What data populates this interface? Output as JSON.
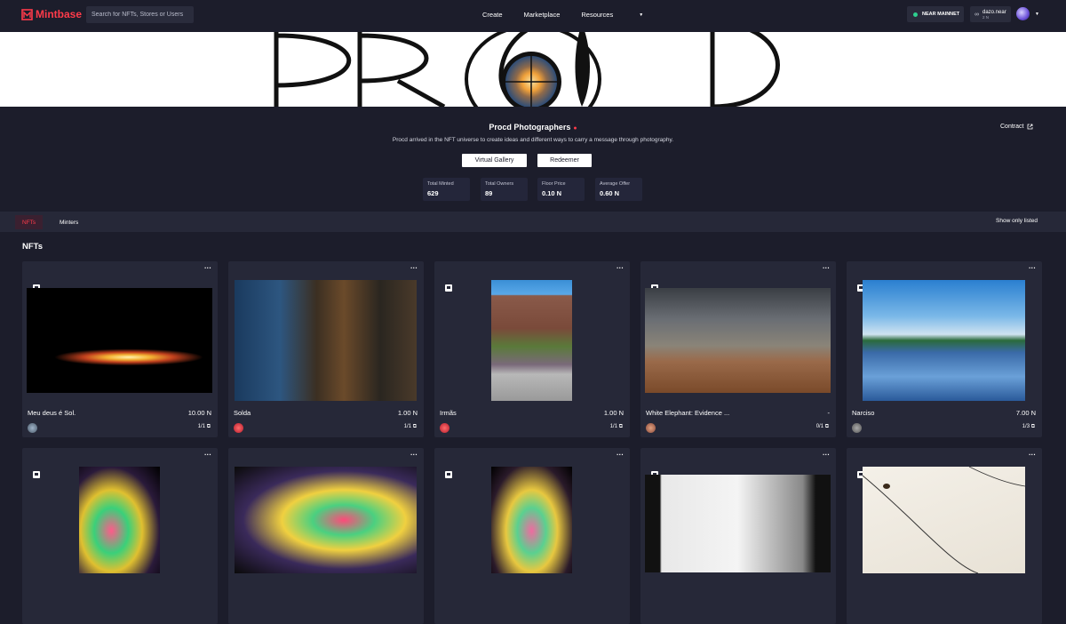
{
  "nav": {
    "logo_text": "Mintbase",
    "search_placeholder": "Search for NFTs, Stores or Users",
    "links": [
      "Create",
      "Marketplace",
      "Resources"
    ],
    "network": "NEAR MAINNET",
    "account_name": "dazo.near",
    "account_balance": "2 N"
  },
  "store": {
    "banner_text": "PROCD",
    "title": "Procd Photographers",
    "description": "Procd arrived in the NFT universe to create ideas and different ways to carry a message through photography.",
    "contract_label": "Contract",
    "buttons": [
      "Virtual Gallery",
      "Redeemer"
    ],
    "stats": [
      {
        "label": "Total Minted",
        "value": "629"
      },
      {
        "label": "Total Owners",
        "value": "89"
      },
      {
        "label": "Floor Price",
        "value": "0.10 N"
      },
      {
        "label": "Average Offer",
        "value": "0.60 N"
      }
    ]
  },
  "tabs": {
    "items": [
      "NFTs",
      "Minters"
    ],
    "active": "NFTs",
    "show_only_listed": "Show only listed"
  },
  "section_title": "NFTs",
  "cards": [
    {
      "name": "Meu deus é Sol.",
      "price": "10.00 N",
      "editions": "1/1",
      "owner_color": "#5a6b7c"
    },
    {
      "name": "Solda",
      "price": "1.00 N",
      "editions": "1/1",
      "owner_color": "#d7263d"
    },
    {
      "name": "Irmãs",
      "price": "1.00 N",
      "editions": "1/1",
      "owner_color": "#d7263d"
    },
    {
      "name": "White Elephant: Evidence ...",
      "price": "-",
      "editions": "0/1",
      "owner_color": "#b06a4a"
    },
    {
      "name": "Narciso",
      "price": "7.00 N",
      "editions": "1/3",
      "owner_color": "#7d7d7d"
    },
    {
      "name": "",
      "price": "",
      "editions": "",
      "owner_color": ""
    },
    {
      "name": "",
      "price": "",
      "editions": "",
      "owner_color": ""
    },
    {
      "name": "",
      "price": "",
      "editions": "",
      "owner_color": ""
    },
    {
      "name": "",
      "price": "",
      "editions": "",
      "owner_color": ""
    },
    {
      "name": "",
      "price": "",
      "editions": "",
      "owner_color": ""
    }
  ],
  "colors": {
    "accent": "#ff3b4a",
    "background": "#1c1d2b",
    "card": "#262838",
    "network_dot": "#2dd08f"
  }
}
